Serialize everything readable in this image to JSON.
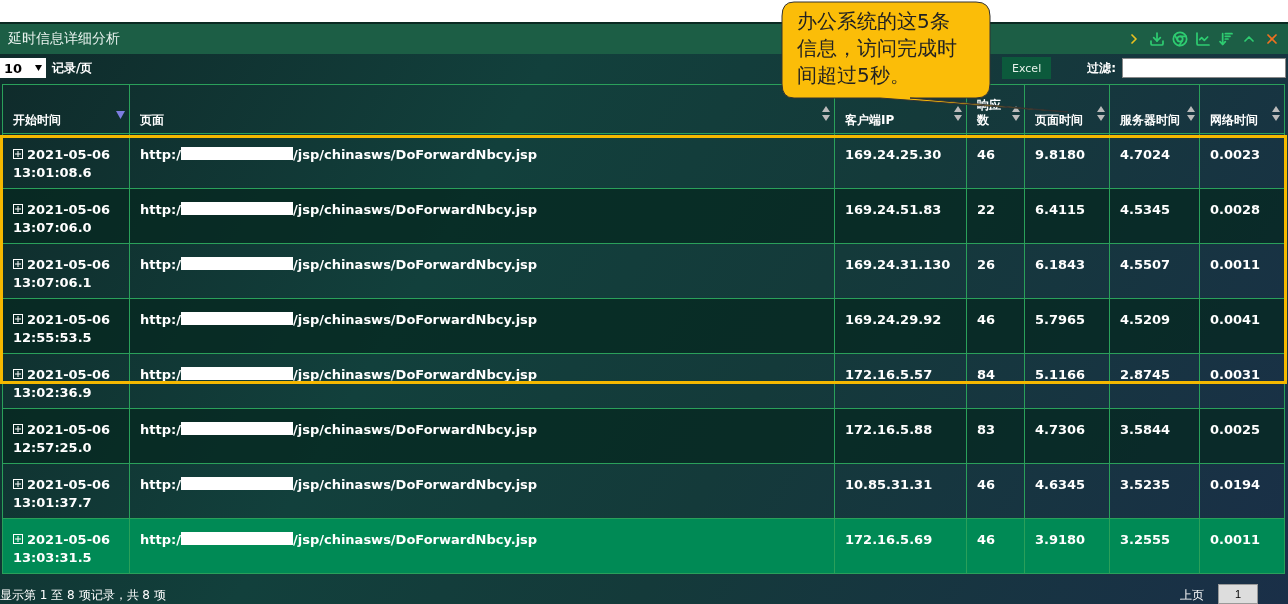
{
  "window": {
    "title": "延时信息详细分析"
  },
  "toolbar": {
    "page_size": "10",
    "page_size_label": "记录/页",
    "export_button": "Excel",
    "filter_label": "过滤:"
  },
  "table": {
    "columns": [
      {
        "label": "开始时间",
        "sorted": true
      },
      {
        "label": "页面",
        "sorted": false
      },
      {
        "label": "客户端IP",
        "sorted": false
      },
      {
        "label": "响应数",
        "sorted": false
      },
      {
        "label": "页面时间",
        "sorted": false
      },
      {
        "label": "服务器时间",
        "sorted": false
      },
      {
        "label": "网络时间",
        "sorted": false
      }
    ],
    "rows": [
      {
        "date": "2021-05-06",
        "time": "13:01:08.6",
        "url_prefix": "http:/",
        "url_suffix": "/jsp/chinasws/DoForwardNbcy.jsp",
        "ip": "169.24.25.30",
        "responses": "46",
        "page_time": "9.8180",
        "server_time": "4.7024",
        "network_time": "0.0023",
        "selected": false
      },
      {
        "date": "2021-05-06",
        "time": "13:07:06.0",
        "url_prefix": "http:/",
        "url_suffix": "/jsp/chinasws/DoForwardNbcy.jsp",
        "ip": "169.24.51.83",
        "responses": "22",
        "page_time": "6.4115",
        "server_time": "4.5345",
        "network_time": "0.0028",
        "selected": false
      },
      {
        "date": "2021-05-06",
        "time": "13:07:06.1",
        "url_prefix": "http:/",
        "url_suffix": "/jsp/chinasws/DoForwardNbcy.jsp",
        "ip": "169.24.31.130",
        "responses": "26",
        "page_time": "6.1843",
        "server_time": "4.5507",
        "network_time": "0.0011",
        "selected": false
      },
      {
        "date": "2021-05-06",
        "time": "12:55:53.5",
        "url_prefix": "http:/",
        "url_suffix": "/jsp/chinasws/DoForwardNbcy.jsp",
        "ip": "169.24.29.92",
        "responses": "46",
        "page_time": "5.7965",
        "server_time": "4.5209",
        "network_time": "0.0041",
        "selected": false
      },
      {
        "date": "2021-05-06",
        "time": "13:02:36.9",
        "url_prefix": "http:/",
        "url_suffix": "/jsp/chinasws/DoForwardNbcy.jsp",
        "ip": "172.16.5.57",
        "responses": "84",
        "page_time": "5.1166",
        "server_time": "2.8745",
        "network_time": "0.0031",
        "selected": false
      },
      {
        "date": "2021-05-06",
        "time": "12:57:25.0",
        "url_prefix": "http:/",
        "url_suffix": "/jsp/chinasws/DoForwardNbcy.jsp",
        "ip": "172.16.5.88",
        "responses": "83",
        "page_time": "4.7306",
        "server_time": "3.5844",
        "network_time": "0.0025",
        "selected": false
      },
      {
        "date": "2021-05-06",
        "time": "13:01:37.7",
        "url_prefix": "http:/",
        "url_suffix": "/jsp/chinasws/DoForwardNbcy.jsp",
        "ip": "10.85.31.31",
        "responses": "46",
        "page_time": "4.6345",
        "server_time": "3.5235",
        "network_time": "0.0194",
        "selected": false
      },
      {
        "date": "2021-05-06",
        "time": "13:03:31.5",
        "url_prefix": "http:/",
        "url_suffix": "/jsp/chinasws/DoForwardNbcy.jsp",
        "ip": "172.16.5.69",
        "responses": "46",
        "page_time": "3.9180",
        "server_time": "3.2555",
        "network_time": "0.0011",
        "selected": true
      }
    ]
  },
  "footer": {
    "info": "显示第 1 至 8 项记录，共 8 项",
    "prev": "上页",
    "current_page": "1"
  },
  "callout": {
    "text": "办公系统的这5条信息，访问完成时间超过5秒。"
  }
}
